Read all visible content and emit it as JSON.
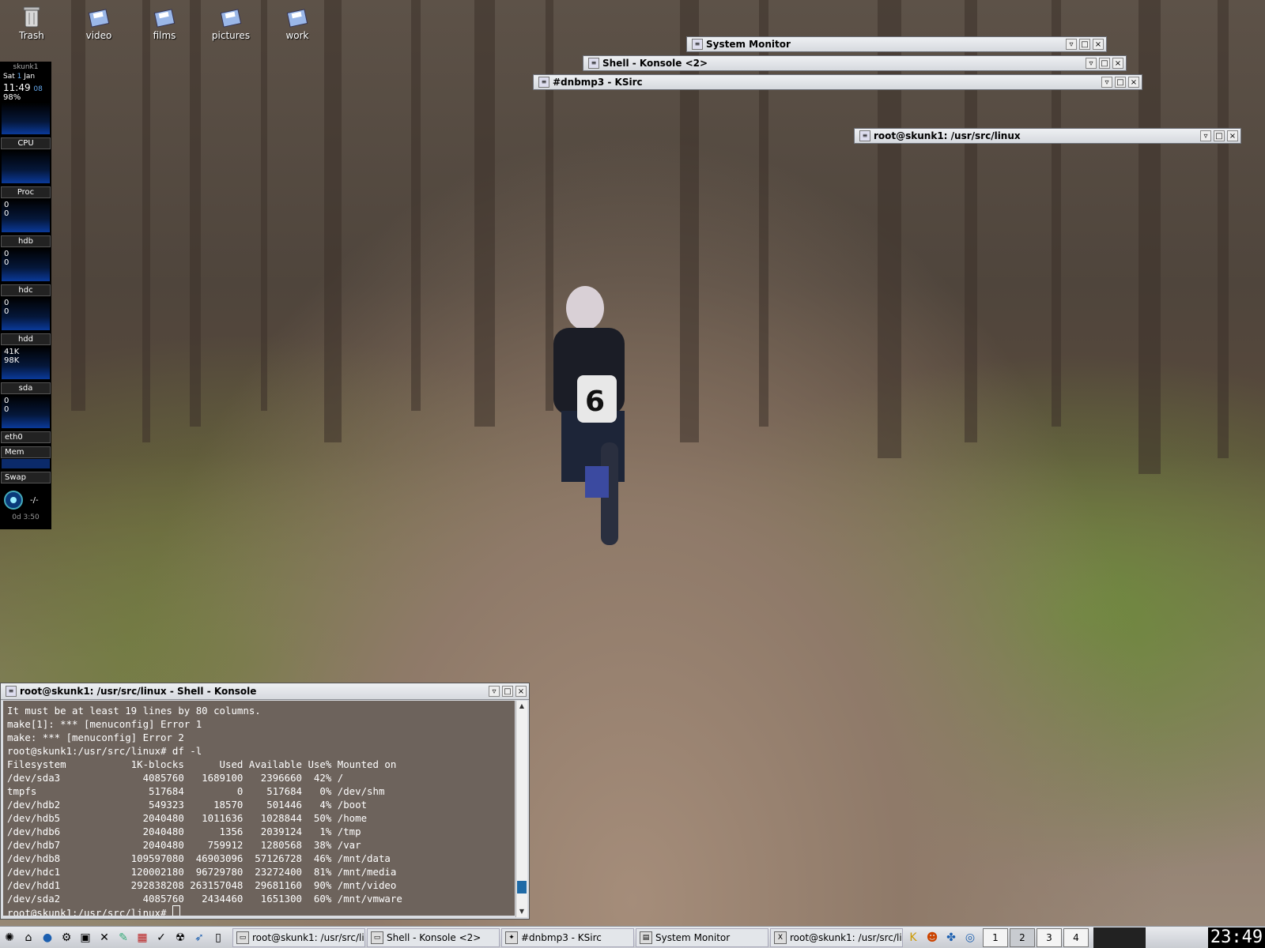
{
  "desktop": {
    "icons": [
      {
        "label": "Trash",
        "icon": "trash-icon"
      },
      {
        "label": "video",
        "icon": "floppy-folder-icon"
      },
      {
        "label": "films",
        "icon": "floppy-folder-icon"
      },
      {
        "label": "pictures",
        "icon": "floppy-folder-icon"
      },
      {
        "label": "work",
        "icon": "floppy-folder-icon"
      }
    ]
  },
  "gkrellm": {
    "host": "skunk1",
    "day": "Sat",
    "date_num": "1",
    "month": "Jan",
    "time": "11:49",
    "time_sec": "08",
    "percent": "98%",
    "cpu_label": "CPU",
    "proc_label": "Proc",
    "proc_vals": [
      "0",
      "0"
    ],
    "hdb_label": "hdb",
    "hdb_vals": [
      "0",
      "0"
    ],
    "hdc_label": "hdc",
    "hdc_vals": [
      "0",
      "0"
    ],
    "hdd_label": "hdd",
    "hdd_vals": [
      "41K",
      "98K"
    ],
    "sda_label": "sda",
    "sda_vals": [
      "0",
      "0"
    ],
    "eth_label": "eth0",
    "mem_label": "Mem",
    "swap_label": "Swap",
    "status": "-/-",
    "uptime": "0d 3:50"
  },
  "windows": {
    "system_monitor": "System Monitor",
    "shell_konsole2": "Shell - Konsole <2>",
    "ksirc": "#dnbmp3 - KSirc",
    "root_shell": "root@skunk1: /usr/src/linux"
  },
  "konsole": {
    "title": "root@skunk1: /usr/src/linux - Shell - Konsole",
    "lines": [
      "It must be at least 19 lines by 80 columns.",
      "make[1]: *** [menuconfig] Error 1",
      "make: *** [menuconfig] Error 2",
      "root@skunk1:/usr/src/linux# df -l",
      "Filesystem           1K-blocks      Used Available Use% Mounted on",
      "/dev/sda3              4085760   1689100   2396660  42% /",
      "tmpfs                   517684         0    517684   0% /dev/shm",
      "/dev/hdb2               549323     18570    501446   4% /boot",
      "/dev/hdb5              2040480   1011636   1028844  50% /home",
      "/dev/hdb6              2040480      1356   2039124   1% /tmp",
      "/dev/hdb7              2040480    759912   1280568  38% /var",
      "/dev/hdb8            109597080  46903096  57126728  46% /mnt/data",
      "/dev/hdc1            120002180  96729780  23272400  81% /mnt/media",
      "/dev/hdd1            292838208 263157048  29681160  90% /mnt/video",
      "/dev/sda2              4085760   2434460   1651300  60% /mnt/vmware"
    ],
    "prompt": "root@skunk1:/usr/src/linux# "
  },
  "taskbar": {
    "tasks": [
      {
        "label": "root@skunk1: /usr/src/linu",
        "icon": "terminal-icon"
      },
      {
        "label": "Shell - Konsole <2>",
        "icon": "terminal-icon"
      },
      {
        "label": "#dnbmp3 - KSirc",
        "icon": "irc-icon"
      },
      {
        "label": "System Monitor",
        "icon": "monitor-icon"
      },
      {
        "label": "root@skunk1: /usr/src/linu",
        "icon": "x-terminal-icon"
      }
    ],
    "desktops": [
      "1",
      "2",
      "3",
      "4"
    ],
    "active_desktop": "2",
    "clock": "23:49"
  }
}
